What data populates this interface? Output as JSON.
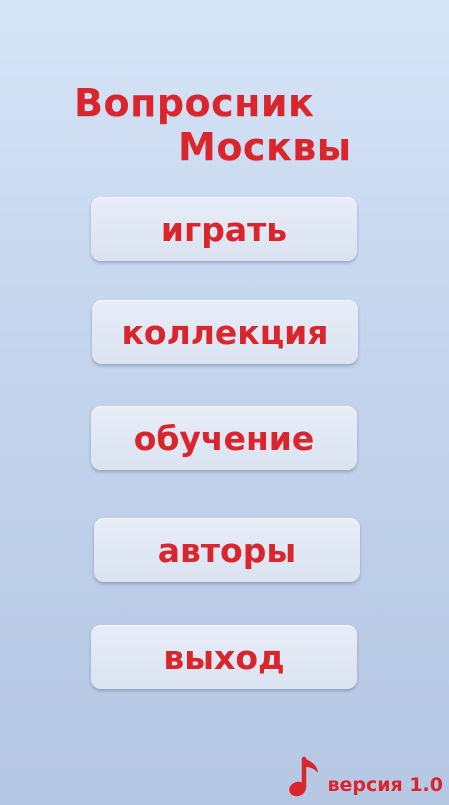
{
  "app": {
    "title_line1": "Вопросник",
    "title_line2": "Москвы"
  },
  "menu": {
    "items": [
      {
        "label": "играть"
      },
      {
        "label": "коллекция"
      },
      {
        "label": "обучение"
      },
      {
        "label": "авторы"
      },
      {
        "label": "выход"
      }
    ]
  },
  "footer": {
    "icon": "music-note-icon",
    "version_label": "версия 1.0"
  },
  "colors": {
    "accent": "#d9252b",
    "button_bg": "#e1e8f5",
    "background_top": "#d6e4f7",
    "background_bottom": "#b6c7e4"
  }
}
